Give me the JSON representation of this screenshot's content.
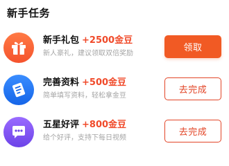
{
  "section": {
    "title": "新手任务"
  },
  "tasks": [
    {
      "name": "新手礼包",
      "reward": "+2500金豆",
      "description": "新人豪礼，建议领取双倍奖励",
      "button_label": "领取",
      "button_style": "filled",
      "icon": "gift-icon",
      "icon_gradient": [
        "#ff7a45",
        "#f5532d"
      ]
    },
    {
      "name": "完善资料",
      "reward": "+500金豆",
      "description": "简单填写资料，轻松拿金豆",
      "button_label": "去完成",
      "button_style": "outline",
      "icon": "profile-form-icon",
      "icon_gradient": [
        "#3a8dff",
        "#1565e8"
      ]
    },
    {
      "name": "五星好评",
      "reward": "+800金豆",
      "description": "给个好评，支持下每日视频",
      "button_label": "去完成",
      "button_style": "outline",
      "icon": "chat-bubble-icon",
      "icon_gradient": [
        "#9a6bff",
        "#6c43e8"
      ]
    }
  ],
  "colors": {
    "accent": "#f15a24",
    "reward_text": "#f04a2a",
    "outline_button": "#e24426",
    "description_text": "#a5a5a5"
  }
}
